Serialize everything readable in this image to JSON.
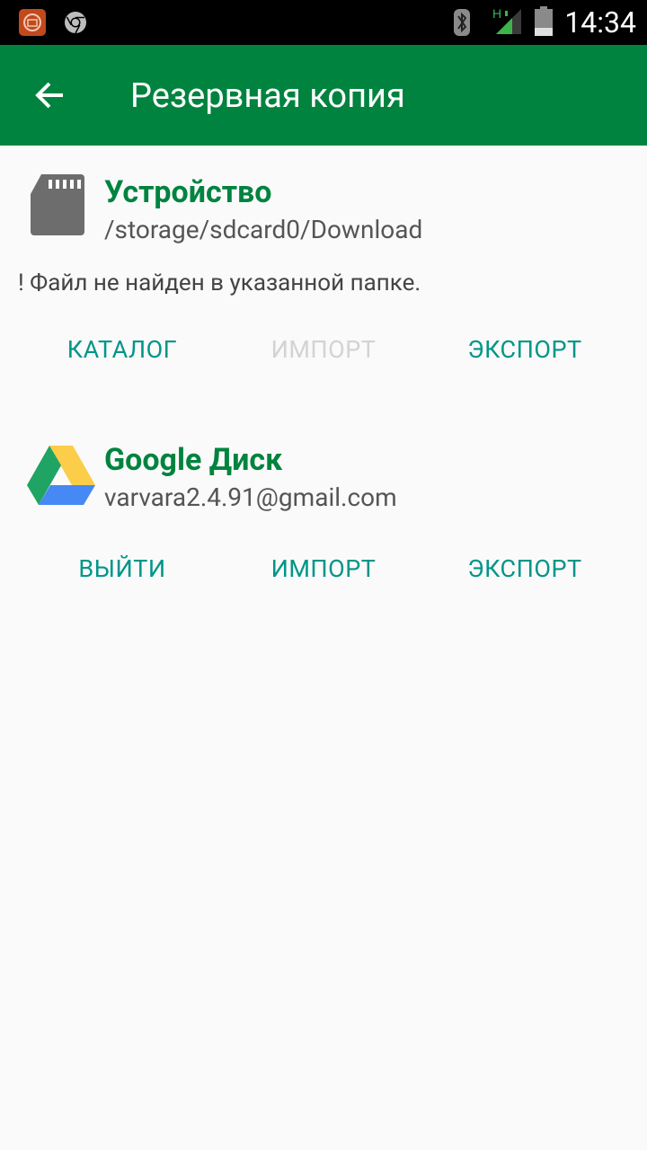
{
  "status_bar": {
    "time": "14:34",
    "signal_badge": "H"
  },
  "app_bar": {
    "title": "Резервная копия",
    "back_icon": "arrow-back-icon",
    "color": "#00833f"
  },
  "device_section": {
    "title": "Устройство",
    "path": "/storage/sdcard0/Download",
    "warning": "! Файл не найден в указанной папке.",
    "icon": "sd-card-icon",
    "buttons": {
      "catalog": "КАТАЛОГ",
      "import": "ИМПОРТ",
      "export": "ЭКСПОРТ"
    },
    "import_enabled": false
  },
  "drive_section": {
    "title": "Google Диск",
    "account": "varvara2.4.91@gmail.com",
    "icon": "google-drive-icon",
    "buttons": {
      "logout": "ВЫЙТИ",
      "import": "ИМПОРТ",
      "export": "ЭКСПОРТ"
    }
  },
  "colors": {
    "accent": "#009688",
    "primary": "#00833f",
    "disabled": "#d3d3d3"
  }
}
